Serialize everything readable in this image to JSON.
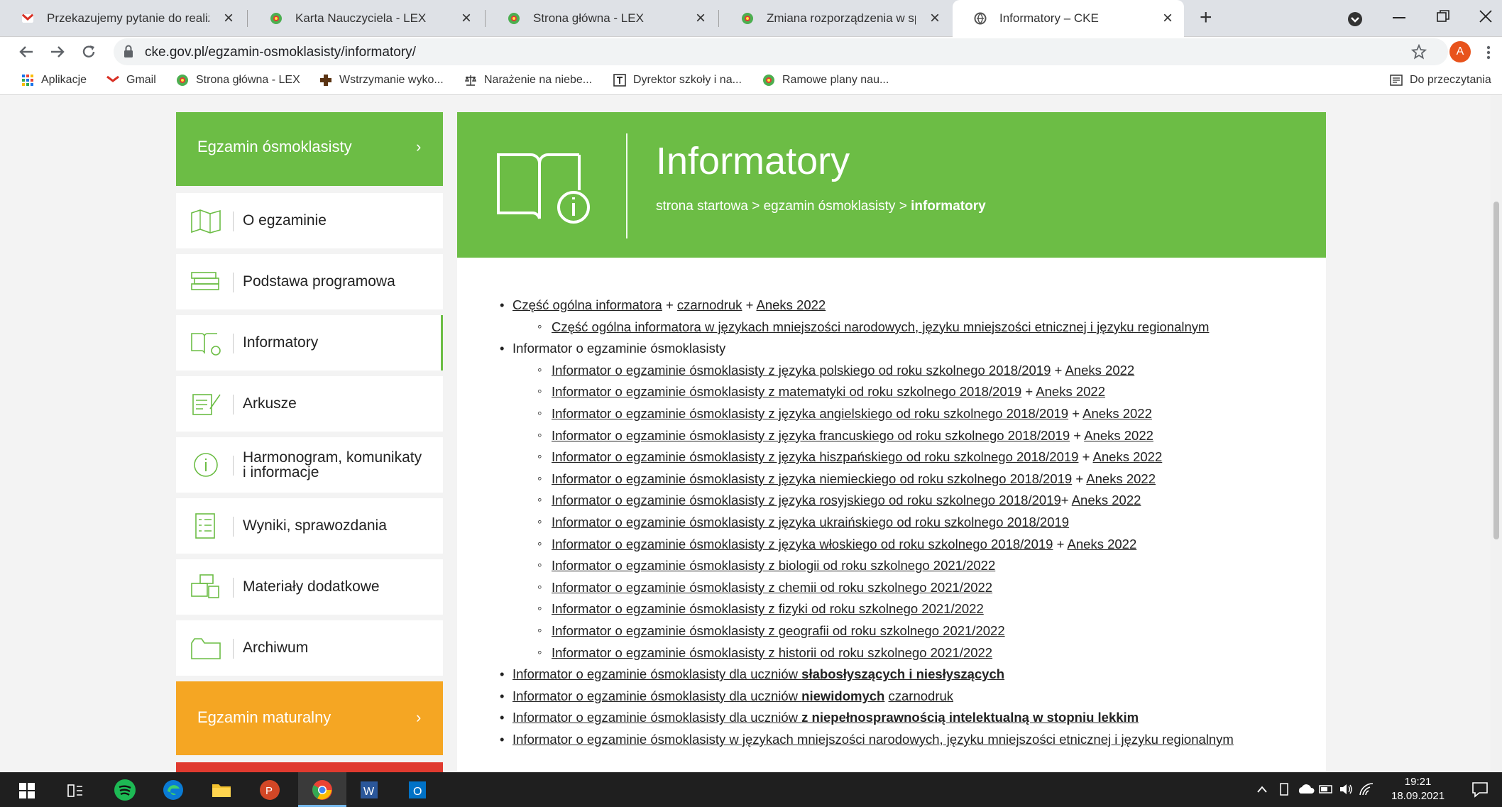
{
  "browser": {
    "tabs": [
      {
        "title": "Przekazujemy pytanie do realizac",
        "icon": "gmail-icon"
      },
      {
        "title": "Karta Nauczyciela - LEX",
        "icon": "lex-icon"
      },
      {
        "title": "Strona główna - LEX",
        "icon": "lex-icon"
      },
      {
        "title": "Zmiana rozporządzenia w sprawie",
        "icon": "lex-icon"
      },
      {
        "title": "Informatory – CKE",
        "icon": "globe-icon"
      }
    ],
    "close_glyph": "×",
    "new_tab_glyph": "+",
    "url": "cke.gov.pl/egzamin-osmoklasisty/informatory/",
    "avatar_letter": "A",
    "bookmarks": [
      {
        "label": "Aplikacje",
        "icon": "apps-grid-icon"
      },
      {
        "label": "Gmail",
        "icon": "gmail-icon"
      },
      {
        "label": "Strona główna - LEX",
        "icon": "lex-icon"
      },
      {
        "label": "Wstrzymanie wyko...",
        "icon": "cross-icon"
      },
      {
        "label": "Narażenie na niebe...",
        "icon": "scales-icon"
      },
      {
        "label": "Dyrektor szkoły i na...",
        "icon": "t-icon"
      },
      {
        "label": "Ramowe plany nau...",
        "icon": "lex-icon"
      }
    ],
    "reading_list": "Do przeczytania"
  },
  "sidebar": {
    "header": "Egzamin ósmoklasisty",
    "chevron": "›",
    "items": [
      {
        "label": "O egzaminie",
        "icon": "map-icon"
      },
      {
        "label": "Podstawa programowa",
        "icon": "books-icon"
      },
      {
        "label": "Informatory",
        "icon": "book-info-icon"
      },
      {
        "label": "Arkusze",
        "icon": "sheet-pen-icon"
      },
      {
        "label": "Harmonogram, komunikaty i informacje",
        "icon": "info-circle-icon"
      },
      {
        "label": "Wyniki, sprawozdania",
        "icon": "checklist-icon"
      },
      {
        "label": "Materiały dodatkowe",
        "icon": "media-icon"
      },
      {
        "label": "Archiwum",
        "icon": "folder-icon"
      }
    ],
    "orange_header": "Egzamin maturalny"
  },
  "hero": {
    "title": "Informatory",
    "crumb_1": "strona startowa",
    "crumb_sep": ">",
    "crumb_2": "egzamin ósmoklasisty",
    "crumb_3": "informatory"
  },
  "content": {
    "plus": "+",
    "item1": {
      "a": "Część ogólna informatora",
      "b": "czarnodruk",
      "c": "Aneks 2022"
    },
    "item1_sub": "Część ogólna informatora w językach mniejszości narodowych, języku mniejszości etnicznej i języku regionalnym",
    "item2": "Informator o egzaminie ósmoklasisty",
    "aneks": "Aneks 2022",
    "subs": [
      "Informator o egzaminie ósmoklasisty z języka polskiego od roku szkolnego 2018/2019",
      "Informator o egzaminie ósmoklasisty z matematyki od roku szkolnego 2018/2019",
      "Informator o egzaminie ósmoklasisty z języka angielskiego od roku szkolnego 2018/2019",
      "Informator o egzaminie ósmoklasisty z języka francuskiego od roku szkolnego 2018/2019",
      "Informator o egzaminie ósmoklasisty z języka hiszpańskiego od roku szkolnego 2018/2019",
      "Informator o egzaminie ósmoklasisty z języka niemieckiego od roku szkolnego 2018/2019",
      "Informator o egzaminie ósmoklasisty z języka rosyjskiego od roku szkolnego 2018/2019",
      "Informator o egzaminie ósmoklasisty z języka ukraińskiego od roku szkolnego 2018/2019",
      "Informator o egzaminie ósmoklasisty z języka włoskiego od roku szkolnego 2018/2019",
      "Informator o egzaminie ósmoklasisty z biologii od roku szkolnego 2021/2022",
      "Informator o egzaminie ósmoklasisty z chemii od roku szkolnego 2021/2022",
      "Informator o egzaminie ósmoklasisty z fizyki od roku szkolnego 2021/2022",
      "Informator o egzaminie ósmoklasisty z geografii od roku szkolnego 2021/2022",
      "Informator o egzaminie ósmoklasisty z historii od roku szkolnego 2021/2022"
    ],
    "item3": {
      "a": "Informator o egzaminie ósmoklasisty dla uczniów ",
      "b": "słabosłyszących i niesłyszących"
    },
    "item4": {
      "a": "Informator o egzaminie ósmoklasisty dla uczniów ",
      "b": "niewidomych",
      "c": "czarnodruk"
    },
    "item5": {
      "a": "Informator o egzaminie ósmoklasisty dla uczniów ",
      "b": "z niepełnosprawnością intelektualną w stopniu lekkim"
    },
    "item6": "Informator o egzaminie ósmoklasisty w językach mniejszości narodowych, języku mniejszości etnicznej i języku regionalnym"
  },
  "taskbar": {
    "time": "19:21",
    "date": "18.09.2021"
  },
  "colors": {
    "green": "#6cbd45",
    "orange": "#f5a623",
    "red": "#e03a2f"
  }
}
